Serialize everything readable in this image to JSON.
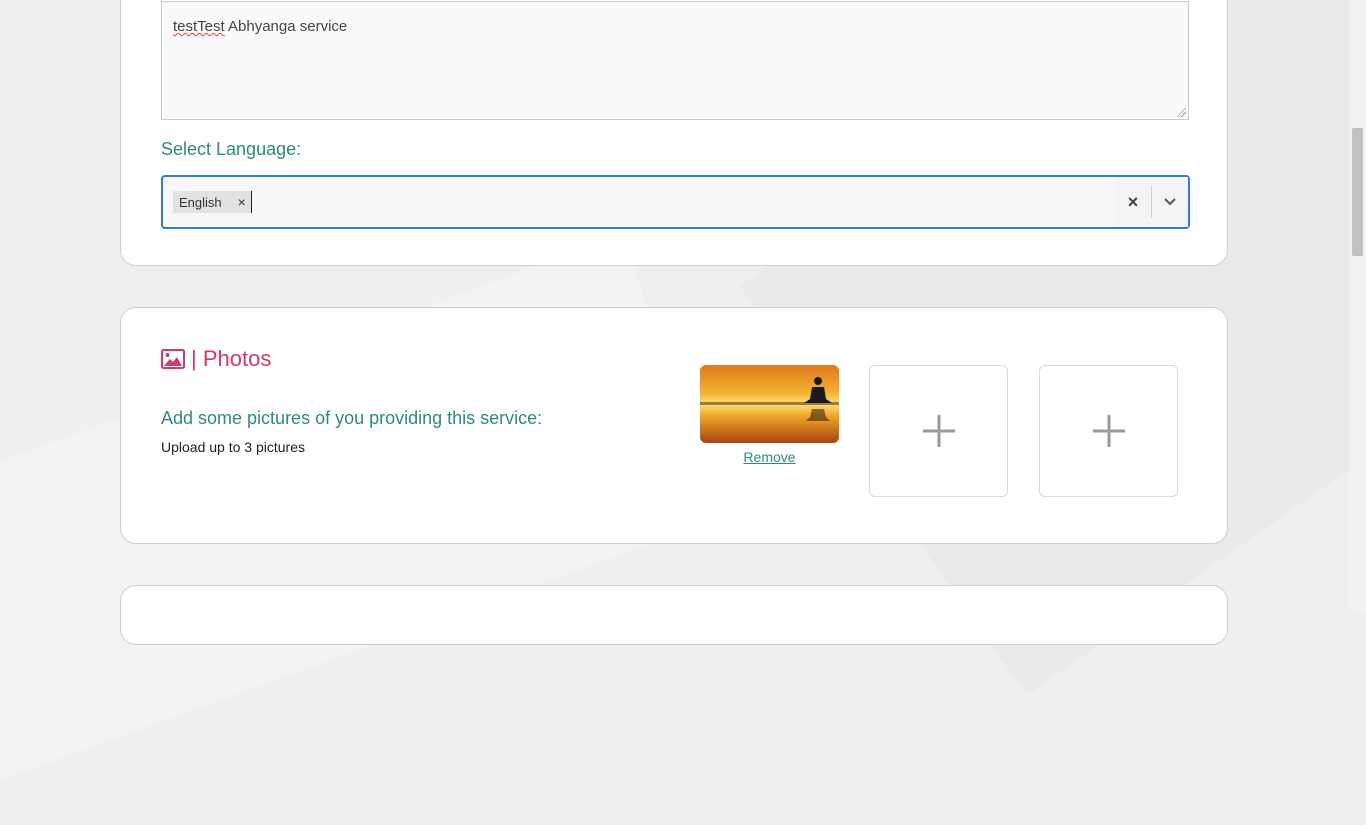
{
  "description": {
    "text_part1": "testTest",
    "text_part2": " Abhyanga service"
  },
  "language": {
    "label": "Select Language:",
    "selected_chip": "English",
    "chip_remove": "×",
    "clear_glyph": "×"
  },
  "photos": {
    "title": "| Photos",
    "heading": "Add some pictures of you providing this service:",
    "note": "Upload up to 3 pictures",
    "remove_label": "Remove",
    "icon": "image-icon"
  },
  "colors": {
    "teal": "#2f8a7b",
    "pink": "#d13a6a",
    "focus_blue": "#2e7fd3"
  }
}
